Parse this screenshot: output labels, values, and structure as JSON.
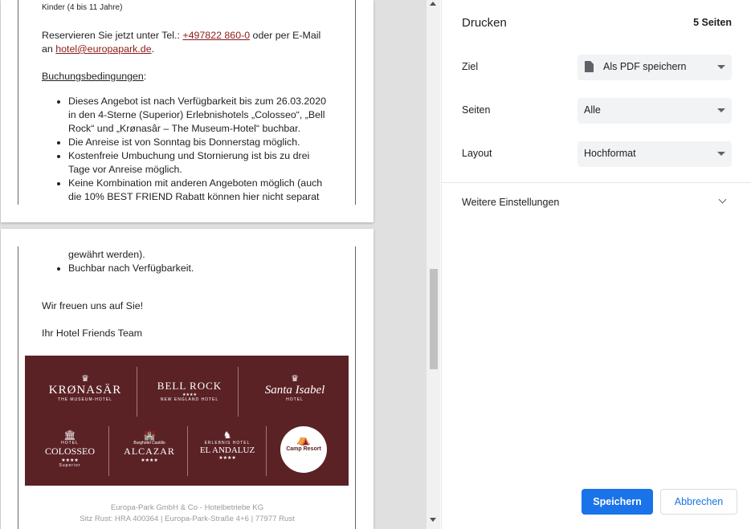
{
  "preview": {
    "page1": {
      "kinder": "Kinder (4 bis 11 Jahre)",
      "reserve_prefix": "Reservieren Sie jetzt unter Tel.: ",
      "phone": "+497822 860-0",
      "reserve_mid": " oder per E-Mail",
      "reserve_an": "an ",
      "email": "hotel@europapark.de",
      "reserve_end": ".",
      "conditions_heading": "Buchungsbedingungen",
      "conditions_colon": ":",
      "bullets": [
        "Dieses Angebot ist nach Verfügbarkeit bis zum 26.03.2020 in den 4-Sterne (Superior) Erlebnishotels „Colosseo“, „Bell Rock“ und „Krønasâr – The Museum-Hotel“ buchbar.",
        "Die Anreise ist von Sonntag bis Donnerstag möglich.",
        "Kostenfreie Umbuchung und Stornierung ist bis zu drei Tage vor Anreise möglich.",
        "Keine Kombination mit anderen Angeboten möglich (auch die 10% BEST FRIEND Rabatt können hier nicht separat"
      ]
    },
    "page2": {
      "continued": "gewährt werden).",
      "bullet_last": "Buchbar nach Verfügbarkeit.",
      "closing": "Wir freuen uns auf Sie!",
      "signature": "Ihr Hotel Friends Team",
      "logos": {
        "kronasar": "KRØNASÄR",
        "kronasar_sub": "THE MUSEUM-HOTEL",
        "bellrock": "BELL ROCK",
        "bellrock_sub": "NEW ENGLAND HOTEL",
        "santaisabel": "Santa Isabel",
        "santaisabel_sub": "HOTEL",
        "colosseo_top": "HOTEL",
        "colosseo": "COLOSSEO",
        "colosseo_sub": "Superior",
        "alcazar_top": "Burghotel Castillo",
        "alcazar": "ALCAZAR",
        "elandaluz_top": "ERLEBNIS HOTEL",
        "elandaluz": "EL ANDALUZ",
        "camp": "Camp Resort",
        "stars": "★★★★"
      },
      "footer_line1": "Europa-Park GmbH & Co - Hotelbetriebe KG",
      "footer_line2": "Sitz Rust: HRA 400364 | Europa-Park-Straße 4+6 | 77977 Rust"
    }
  },
  "panel": {
    "title": "Drucken",
    "page_count": "5 Seiten",
    "destination_label": "Ziel",
    "destination_value": "Als PDF speichern",
    "pages_label": "Seiten",
    "pages_value": "Alle",
    "layout_label": "Layout",
    "layout_value": "Hochformat",
    "more_settings": "Weitere Einstellungen",
    "save": "Speichern",
    "cancel": "Abbrechen"
  },
  "colors": {
    "accent": "#1a73e8",
    "banner": "#5b2226",
    "link": "#8b1a1a"
  }
}
